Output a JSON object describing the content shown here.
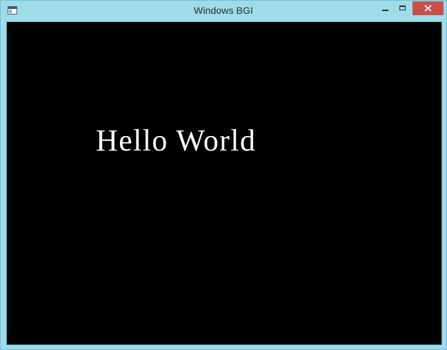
{
  "window": {
    "title": "Windows BGI",
    "icons": {
      "app": "app-window-icon",
      "minimize": "minimize-icon",
      "maximize": "maximize-icon",
      "close": "close-icon"
    },
    "colors": {
      "frame": "#9fdcea",
      "close_button": "#c7504d",
      "canvas_background": "#000000",
      "text": "#ffffff"
    }
  },
  "canvas": {
    "text": "Hello World"
  }
}
